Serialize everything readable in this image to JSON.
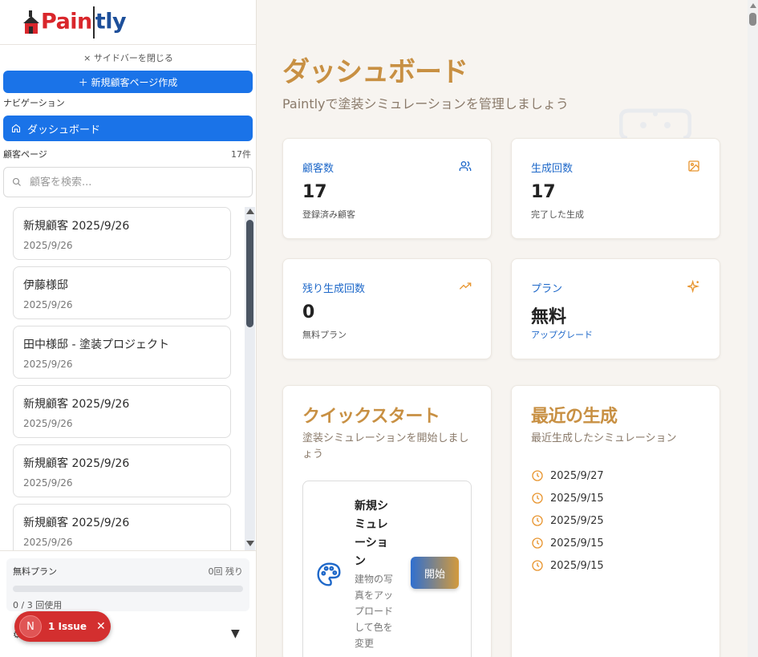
{
  "brand": {
    "logo_text_1": "Pa",
    "logo_text_2": "in",
    "logo_text_3": "tly"
  },
  "sidebar": {
    "close_label": "× サイドバーを閉じる",
    "new_page_label": "＋ 新規顧客ページ作成",
    "nav_label": "ナビゲーション",
    "dashboard_label": "ダッシュボード",
    "customers_label": "顧客ページ",
    "customers_count": "17件",
    "search_placeholder": "顧客を検索...",
    "customers": [
      {
        "name": "新規顧客 2025/9/26",
        "date": "2025/9/26"
      },
      {
        "name": "伊藤様邸",
        "date": "2025/9/26"
      },
      {
        "name": "田中様邸 - 塗装プロジェクト",
        "date": "2025/9/26"
      },
      {
        "name": "新規顧客 2025/9/26",
        "date": "2025/9/26"
      },
      {
        "name": "新規顧客 2025/9/26",
        "date": "2025/9/26"
      },
      {
        "name": "新規顧客 2025/9/26",
        "date": "2025/9/26"
      }
    ],
    "plan": {
      "name": "無料プラン",
      "remaining": "0回 残り",
      "usage": "0 / 3 回使用",
      "usage_fraction": 0
    },
    "issue": {
      "avatar": "N",
      "label": "1 Issue"
    }
  },
  "main": {
    "title": "ダッシュボード",
    "subtitle": "Paintlyで塗装シミュレーションを管理しましょう",
    "stats": [
      {
        "label": "顧客数",
        "value": "17",
        "sub": "登録済み顧客",
        "icon": "users-icon"
      },
      {
        "label": "生成回数",
        "value": "17",
        "sub": "完了した生成",
        "icon": "image-icon"
      },
      {
        "label": "残り生成回数",
        "value": "0",
        "sub": "無料プラン",
        "icon": "trending-up-icon"
      },
      {
        "label": "プラン",
        "value": "無料",
        "sub": "アップグレード",
        "icon": "sparkles-icon"
      }
    ],
    "quickstart": {
      "title": "クイックスタート",
      "subtitle": "塗装シミュレーションを開始しましょう",
      "card_title": "新規シミュレーション",
      "card_desc": "建物の写真をアップロードして色を変更",
      "button": "開始"
    },
    "recent": {
      "title": "最近の生成",
      "subtitle": "最近生成したシミュレーション",
      "items": [
        "2025/9/27",
        "2025/9/15",
        "2025/9/25",
        "2025/9/15",
        "2025/9/15"
      ]
    }
  },
  "colors": {
    "accent_blue": "#1a73e8",
    "title_gold": "#c89043",
    "issue_red": "#d32f2f",
    "icon_orange": "#e8952f"
  }
}
